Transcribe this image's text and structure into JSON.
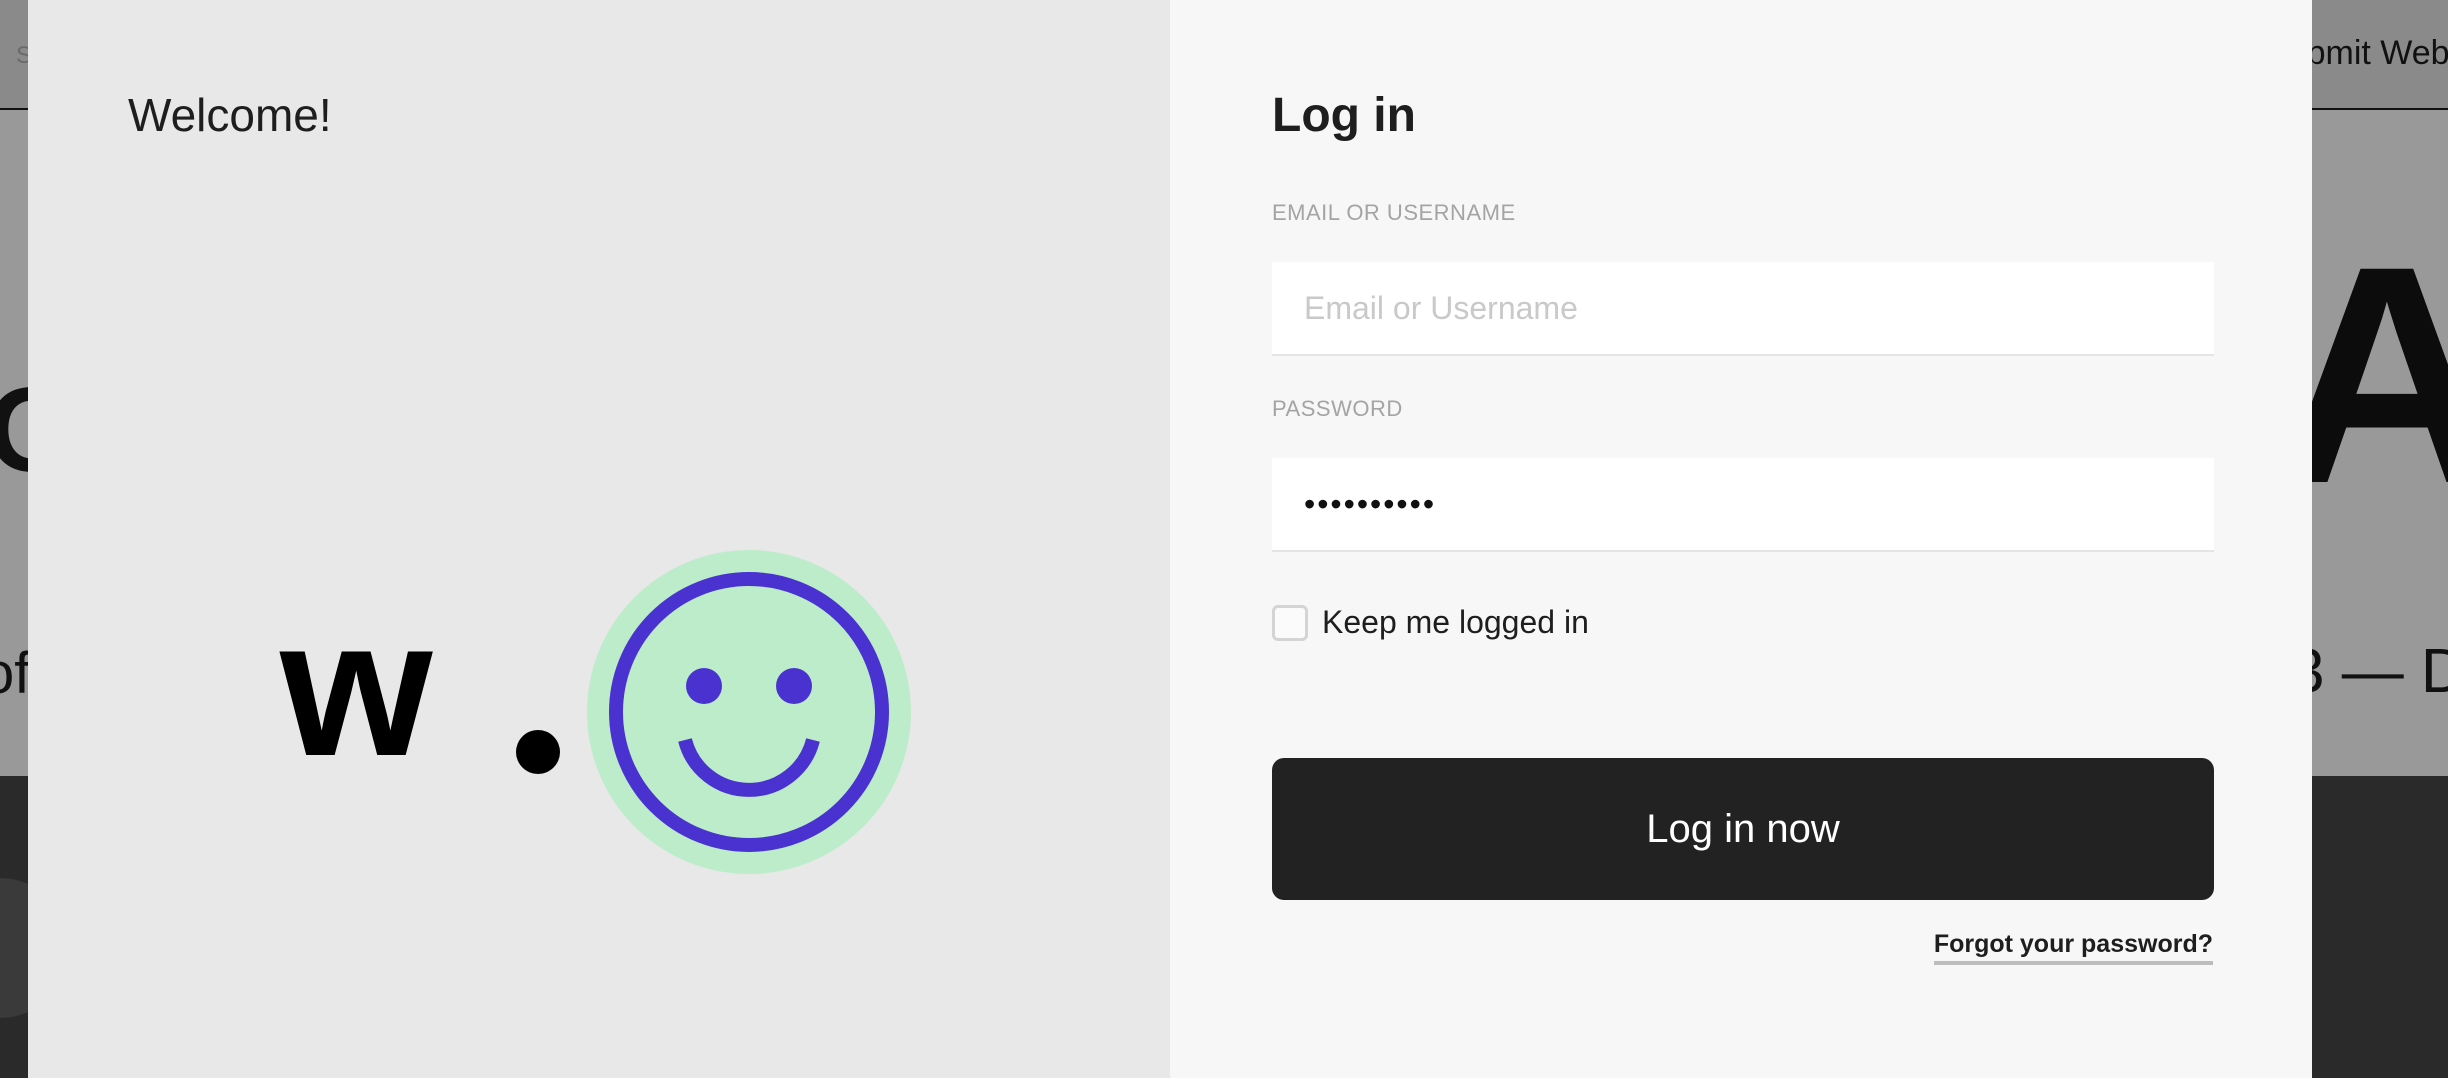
{
  "background": {
    "search_fragment": "S",
    "submit_label": "Submit Website",
    "big_left": "O",
    "big_right": "AY",
    "mid_left": "of",
    "mid_right": "3 — D"
  },
  "modal": {
    "welcome": "Welcome!",
    "logo": {
      "letter": "w.",
      "smiley_fill": "#bdeccb",
      "smiley_stroke": "#4a32d0"
    },
    "login": {
      "title": "Log in",
      "email_label": "EMAIL OR USERNAME",
      "email_placeholder": "Email or Username",
      "email_value": "",
      "password_label": "PASSWORD",
      "password_value": "••••••••••",
      "remember_label": "Keep me logged in",
      "remember_checked": false,
      "submit_label": "Log in now",
      "forgot_label": "Forgot your password?"
    }
  },
  "colors": {
    "button": "#222222",
    "left_panel": "#e8e8e8",
    "right_panel": "#f7f7f7"
  }
}
